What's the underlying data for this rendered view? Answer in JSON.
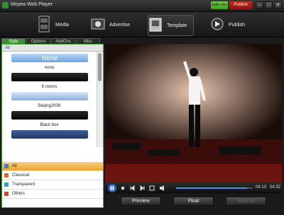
{
  "window": {
    "title": "Moyea Web Player",
    "addons_label": "Add-ons",
    "publish_label": "Publish",
    "min": "–",
    "max": "□",
    "close": "✕"
  },
  "nav": [
    {
      "label": "Media",
      "icon": "film-icon"
    },
    {
      "label": "Advertise",
      "icon": "advertise-icon"
    },
    {
      "label": "Template",
      "icon": "template-icon"
    },
    {
      "label": "Publish",
      "icon": "publish-icon"
    }
  ],
  "tabs": [
    "Style",
    "Options",
    "AddOns",
    "Misc"
  ],
  "sidebar": {
    "filter_label": "All",
    "templates": [
      {
        "label": "None",
        "type": "none"
      },
      {
        "label": "none",
        "type": "dark"
      },
      {
        "label": "6 rooms",
        "type": "blue"
      },
      {
        "label": "Beijing2008",
        "type": "dark"
      },
      {
        "label": "Black box",
        "type": "box"
      }
    ],
    "categories": [
      {
        "label": "All",
        "color": "#4b79c8",
        "active": true
      },
      {
        "label": "Classical",
        "color": "#d96a2d",
        "active": false
      },
      {
        "label": "Transparent",
        "color": "#2f9bd3",
        "active": false
      },
      {
        "label": "Others",
        "color": "#d1452f",
        "active": false
      }
    ]
  },
  "player": {
    "time_current": "04:13",
    "time_total": "04:32",
    "preview_label": "Preview",
    "float_label": "Float",
    "stop_ad_label": "Stop ad"
  }
}
